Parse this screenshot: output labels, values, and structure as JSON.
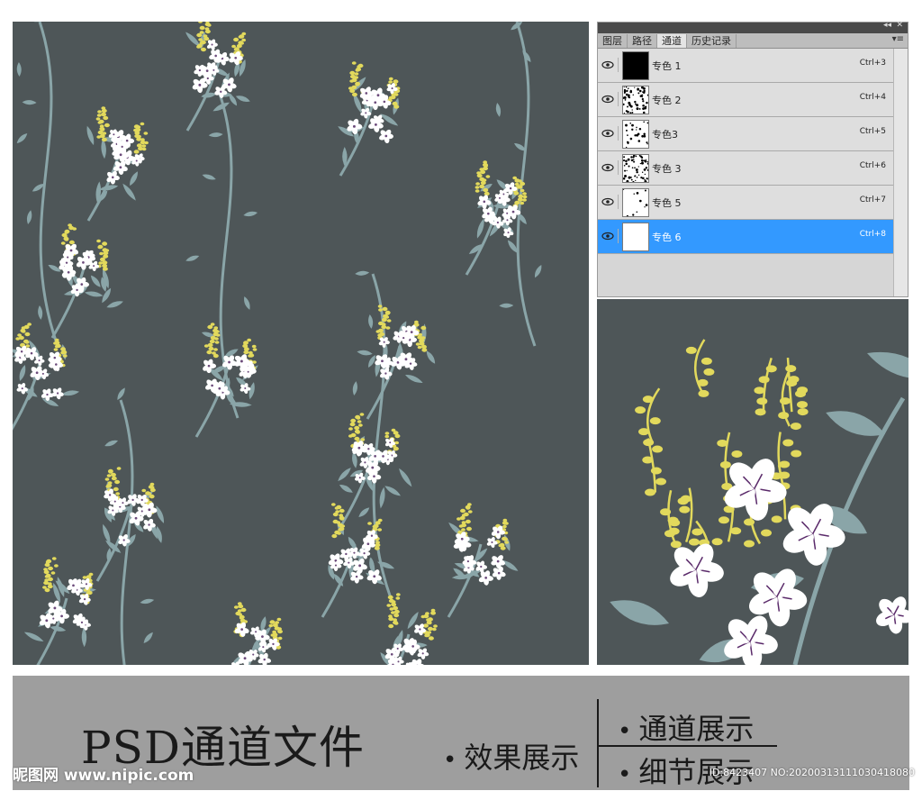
{
  "panel": {
    "tabs": [
      "图层",
      "路径",
      "通道",
      "历史记录"
    ],
    "active_tab": 2,
    "collapse_icon": "double-chevron-icon",
    "close_icon": "close-icon",
    "menu_icon": "panel-menu-icon"
  },
  "channels": [
    {
      "name": "专色 1",
      "shortcut": "Ctrl+3",
      "thumb": "black"
    },
    {
      "name": "专色 2",
      "shortcut": "Ctrl+4",
      "thumb": "dense"
    },
    {
      "name": "专色3",
      "shortcut": "Ctrl+5",
      "thumb": "sparse"
    },
    {
      "name": "专色 3",
      "shortcut": "Ctrl+6",
      "thumb": "dense"
    },
    {
      "name": "专色 5",
      "shortcut": "Ctrl+7",
      "thumb": "light"
    },
    {
      "name": "专色 6",
      "shortcut": "Ctrl+8",
      "thumb": "white",
      "selected": true
    }
  ],
  "banner": {
    "title": "PSD通道文件",
    "effect": "效果展示",
    "channel": "通道展示",
    "detail": "细节展示",
    "bullet": "•"
  },
  "watermark": {
    "site": "昵图网 www.nipic.com",
    "id": "ID:8423407 NO:20200313111030418080"
  },
  "colors": {
    "background": "#4e5658",
    "leaf": "#8aa5a8",
    "flower": "#ffffff",
    "yellow": "#e2d95c",
    "selection": "#3399ff",
    "banner": "#9e9e9e"
  }
}
